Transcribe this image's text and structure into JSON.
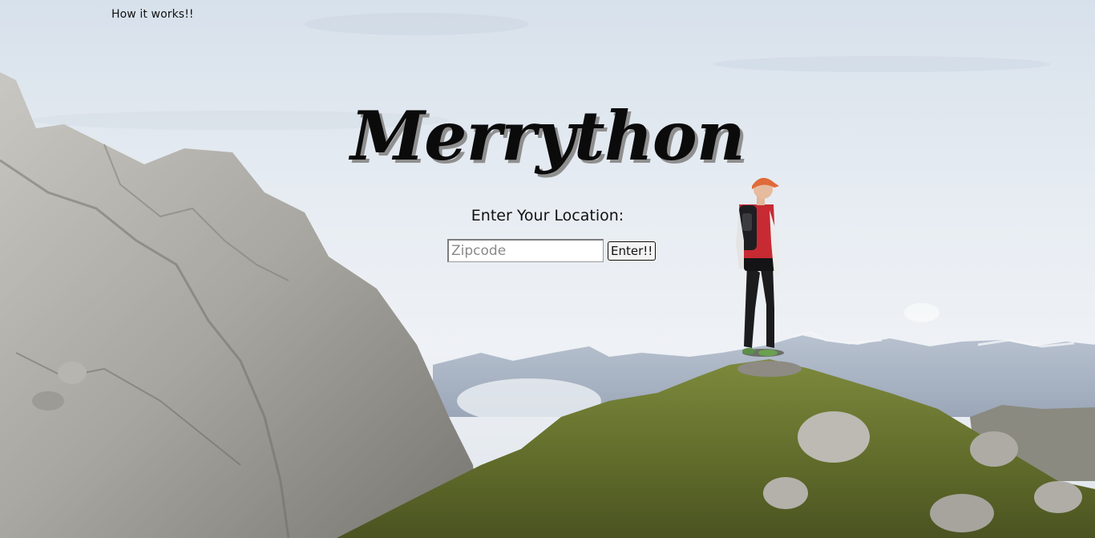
{
  "nav": {
    "how_it_works": "How it works!!"
  },
  "hero": {
    "title": "Merrython",
    "subtitle": "Enter Your Location:"
  },
  "form": {
    "zip_placeholder": "Zipcode",
    "zip_value": "",
    "submit_label": "Enter!!"
  },
  "background": {
    "scene": "mountain-runner-photo",
    "sky_color": "#e6ecf2",
    "rock_color": "#a9a7a2",
    "grass_color": "#6f7a32"
  }
}
